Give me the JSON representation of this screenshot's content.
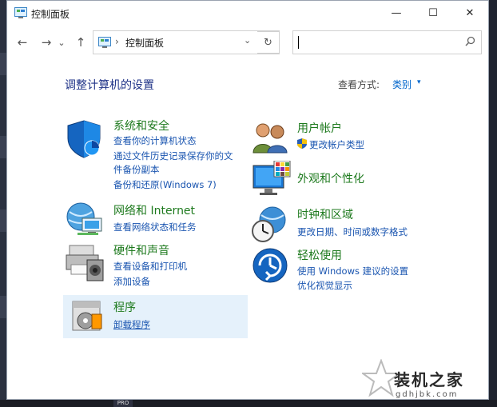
{
  "window": {
    "title": "控制面板"
  },
  "titlebar": {
    "min": "—",
    "max": "☐",
    "close": "✕"
  },
  "nav": {
    "back": "←",
    "forward": "→",
    "recent": "⌄",
    "up": "↑",
    "refresh": "↻"
  },
  "address": {
    "separator": "›",
    "location": "控制面板",
    "dropdown": "⌄"
  },
  "search": {
    "value": "",
    "icon": "search-icon"
  },
  "page": {
    "heading": "调整计算机的设置",
    "view_by_label": "查看方式:",
    "view_by_value": "类别",
    "view_by_caret": "▾"
  },
  "categories": {
    "system": {
      "title": "系统和安全",
      "links": [
        "查看你的计算机状态",
        "通过文件历史记录保存你的文",
        "件备份副本",
        "备份和还原(Windows 7)"
      ]
    },
    "network": {
      "title": "网络和 Internet",
      "links": [
        "查看网络状态和任务"
      ]
    },
    "hardware": {
      "title": "硬件和声音",
      "links": [
        "查看设备和打印机",
        "添加设备"
      ]
    },
    "programs": {
      "title": "程序",
      "links": [
        "卸载程序"
      ]
    },
    "user": {
      "title": "用户帐户",
      "links": [
        "更改帐户类型"
      ]
    },
    "appearance": {
      "title": "外观和个性化",
      "links": []
    },
    "clock": {
      "title": "时钟和区域",
      "links": [
        "更改日期、时间或数字格式"
      ]
    },
    "ease": {
      "title": "轻松使用",
      "links": [
        "使用 Windows 建议的设置",
        "优化视觉显示"
      ]
    }
  },
  "watermark": {
    "text": "装机之家",
    "url": "gdhjbk.com"
  },
  "taskbar": {
    "item": "PRO"
  }
}
